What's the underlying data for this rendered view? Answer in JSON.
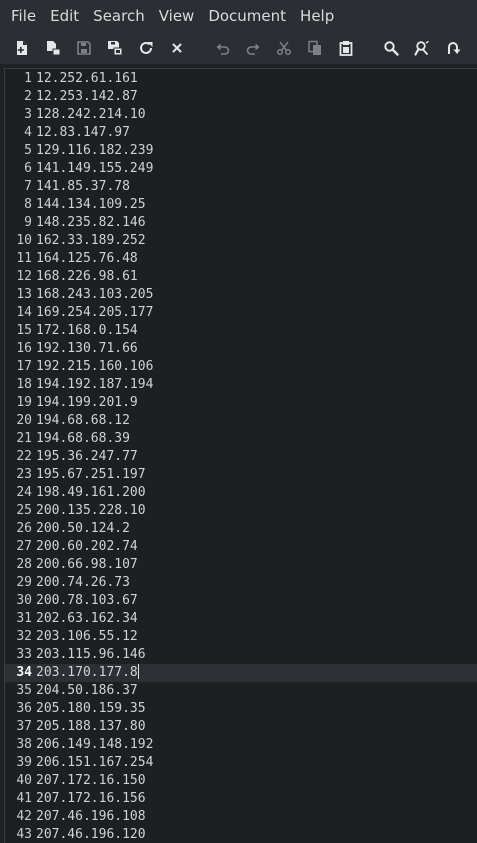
{
  "menu": [
    "File",
    "Edit",
    "Search",
    "View",
    "Document",
    "Help"
  ],
  "toolbar": {
    "colors": {
      "icon": "#e4e6e9",
      "icon_disabled": "#7c8087"
    },
    "buttons": [
      {
        "name": "new-file-icon",
        "enabled": true
      },
      {
        "name": "new-window-icon",
        "enabled": true
      },
      {
        "name": "save-icon",
        "enabled": false
      },
      {
        "name": "save-as-icon",
        "enabled": true
      },
      {
        "name": "reload-icon",
        "enabled": true
      },
      {
        "name": "close-icon",
        "enabled": true
      },
      {
        "name": "undo-icon",
        "enabled": false
      },
      {
        "name": "redo-icon",
        "enabled": false
      },
      {
        "name": "cut-icon",
        "enabled": false
      },
      {
        "name": "copy-icon",
        "enabled": false
      },
      {
        "name": "paste-icon",
        "enabled": true
      },
      {
        "name": "search-icon",
        "enabled": true
      },
      {
        "name": "find-replace-icon",
        "enabled": true
      },
      {
        "name": "go-to-line-icon",
        "enabled": true
      }
    ]
  },
  "editor": {
    "current_line": 34,
    "colors": {
      "background": "#1d1f23",
      "current_line": "#2c2f34",
      "text": "#d0d2d5"
    },
    "lines": [
      "12.252.61.161",
      "12.253.142.87",
      "128.242.214.10",
      "12.83.147.97",
      "129.116.182.239",
      "141.149.155.249",
      "141.85.37.78",
      "144.134.109.25",
      "148.235.82.146",
      "162.33.189.252",
      "164.125.76.48",
      "168.226.98.61",
      "168.243.103.205",
      "169.254.205.177",
      "172.168.0.154",
      "192.130.71.66",
      "192.215.160.106",
      "194.192.187.194",
      "194.199.201.9",
      "194.68.68.12",
      "194.68.68.39",
      "195.36.247.77",
      "195.67.251.197",
      "198.49.161.200",
      "200.135.228.10",
      "200.50.124.2",
      "200.60.202.74",
      "200.66.98.107",
      "200.74.26.73",
      "200.78.103.67",
      "202.63.162.34",
      "203.106.55.12",
      "203.115.96.146",
      "203.170.177.8",
      "204.50.186.37",
      "205.180.159.35",
      "205.188.137.80",
      "206.149.148.192",
      "206.151.167.254",
      "207.172.16.150",
      "207.172.16.156",
      "207.46.196.108",
      "207.46.196.120"
    ]
  }
}
